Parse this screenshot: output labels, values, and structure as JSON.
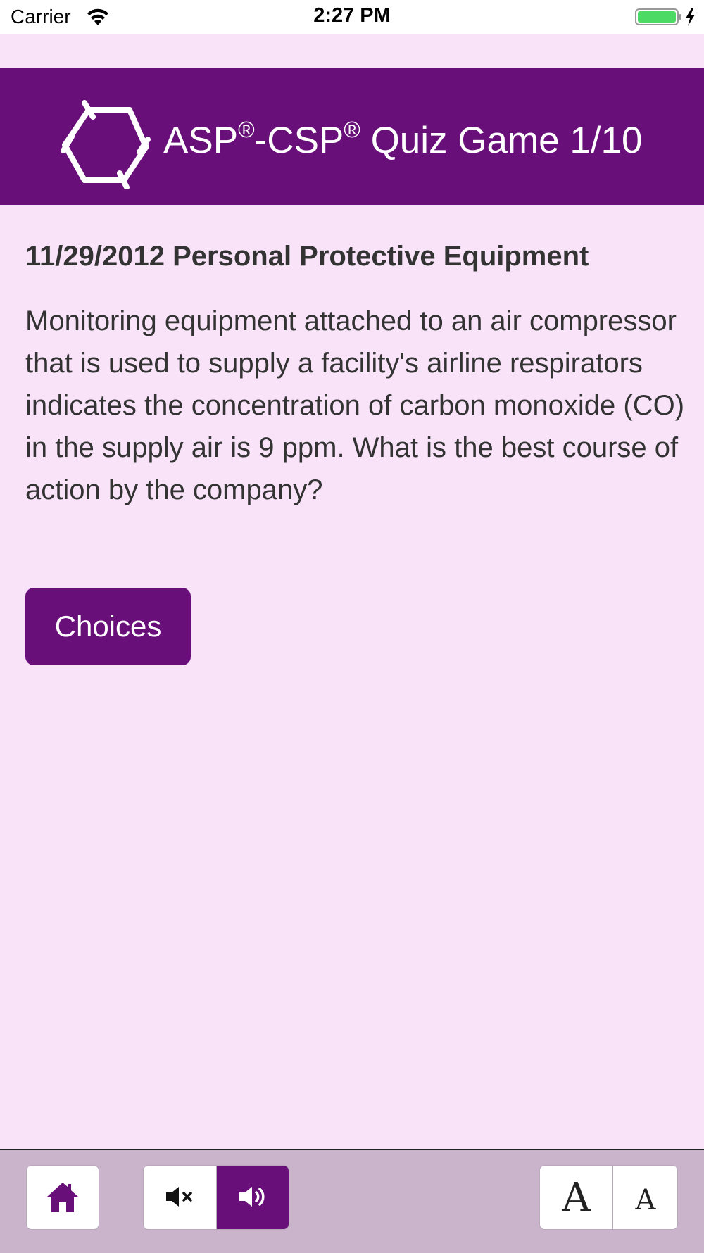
{
  "status_bar": {
    "carrier": "Carrier",
    "time": "2:27 PM"
  },
  "header": {
    "title_part1": "ASP",
    "title_sup1": "®",
    "title_part2": "-CSP",
    "title_sup2": "®",
    "title_part3": " Quiz Game 1/10",
    "logo_icon": "hexagon-logo-icon"
  },
  "question": {
    "heading": "11/29/2012 Personal Protective Equipment",
    "text": "Monitoring equipment attached to an air compressor that is used to supply a facility's airline respirators indicates the concentration of carbon monoxide (CO) in the supply air is 9 ppm. What is the best course of action by the company?"
  },
  "choices_button": {
    "label": "Choices"
  },
  "toolbar": {
    "home_icon": "home-icon",
    "mute_icon": "speaker-mute-icon",
    "sound_icon": "speaker-on-icon",
    "font_large_label": "A",
    "font_small_label": "A",
    "sound_on": true
  },
  "colors": {
    "brand_purple": "#690f7a",
    "background": "#f8e3f8",
    "toolbar_bg": "#c9b4cb"
  }
}
